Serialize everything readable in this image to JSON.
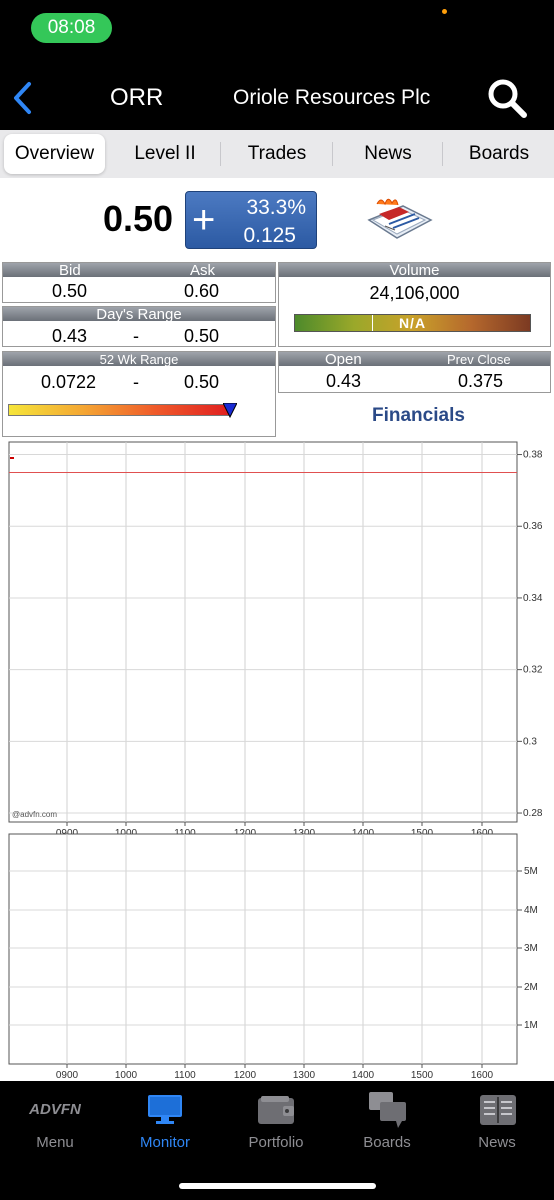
{
  "status": {
    "time": "08:08"
  },
  "header": {
    "ticker": "ORR",
    "company": "Oriole Resources Plc"
  },
  "tabs": [
    {
      "label": "Overview",
      "active": true
    },
    {
      "label": "Level II"
    },
    {
      "label": "Trades"
    },
    {
      "label": "News"
    },
    {
      "label": "Boards"
    }
  ],
  "quote": {
    "price": "0.50",
    "change_sign": "+",
    "change_pct": "33.3%",
    "change_abs": "0.125"
  },
  "stats": {
    "bid_label": "Bid",
    "bid": "0.50",
    "ask_label": "Ask",
    "ask": "0.60",
    "volume_label": "Volume",
    "volume": "24,106,000",
    "volume_bar_text": "N/A",
    "days_range_label": "Day's Range",
    "day_low": "0.43",
    "day_high": "0.50",
    "range_sep": "-",
    "wk52_label": "52 Wk Range",
    "wk52_low": "0.0722",
    "wk52_high": "0.50",
    "wk52_position": 1.0,
    "open_label": "Open",
    "open": "0.43",
    "prev_close_label": "Prev Close",
    "prev_close": "0.375"
  },
  "financials_link": "Financials",
  "chart_data": [
    {
      "type": "line",
      "xlabel": "",
      "ylabel": "",
      "x_ticks": [
        "0900",
        "1000",
        "1100",
        "1200",
        "1300",
        "1400",
        "1500",
        "1600"
      ],
      "y_ticks": [
        "0.38",
        "0.36",
        "0.34",
        "0.32",
        "0.3",
        "0.28"
      ],
      "ylim": [
        0.2775,
        0.3835
      ],
      "reference_line": {
        "label": "Prev Close",
        "value": 0.375,
        "color": "#e05050"
      },
      "watermark": "@advfn.com",
      "grid": true
    },
    {
      "type": "bar",
      "xlabel": "",
      "ylabel": "",
      "x_ticks": [
        "0900",
        "1000",
        "1100",
        "1200",
        "1300",
        "1400",
        "1500",
        "1600"
      ],
      "y_ticks": [
        "5M",
        "4M",
        "3M",
        "2M",
        "1M"
      ],
      "grid": true
    }
  ],
  "bottom_nav": [
    {
      "label": "Menu",
      "icon": "advfn-logo-icon",
      "logo_text": "ADVFN"
    },
    {
      "label": "Monitor",
      "icon": "monitor-icon",
      "active": true
    },
    {
      "label": "Portfolio",
      "icon": "wallet-icon"
    },
    {
      "label": "Boards",
      "icon": "chat-bubbles-icon"
    },
    {
      "label": "News",
      "icon": "newspaper-icon"
    }
  ],
  "colors": {
    "accent": "#2f86f5",
    "status_pill": "#34c759",
    "change_box": "#3b68b3",
    "financials": "#2b4a87"
  }
}
